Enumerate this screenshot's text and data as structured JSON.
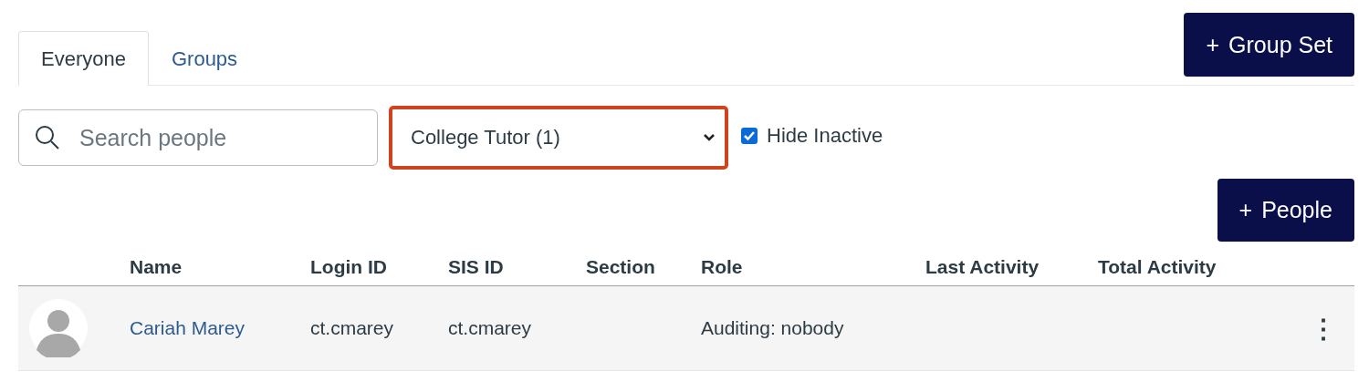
{
  "tabs": [
    {
      "label": "Everyone",
      "selected": true
    },
    {
      "label": "Groups",
      "selected": false
    }
  ],
  "group_set_button": {
    "icon": "+",
    "label": "Group Set"
  },
  "search": {
    "placeholder": "Search people"
  },
  "role_filter": {
    "value": "College Tutor (1)",
    "highlighted": true
  },
  "hide_inactive": {
    "label": "Hide Inactive",
    "checked": true
  },
  "people_button": {
    "icon": "+",
    "label": "People"
  },
  "table": {
    "columns": [
      "Name",
      "Login ID",
      "SIS ID",
      "Section",
      "Role",
      "Last Activity",
      "Total Activity"
    ],
    "rows": [
      {
        "name": "Cariah Marey",
        "login_id": "ct.cmarey",
        "sis_id": "ct.cmarey",
        "section": "",
        "role": "Auditing: nobody",
        "last_activity": "",
        "total_activity": "",
        "menu": "⋮"
      }
    ]
  }
}
